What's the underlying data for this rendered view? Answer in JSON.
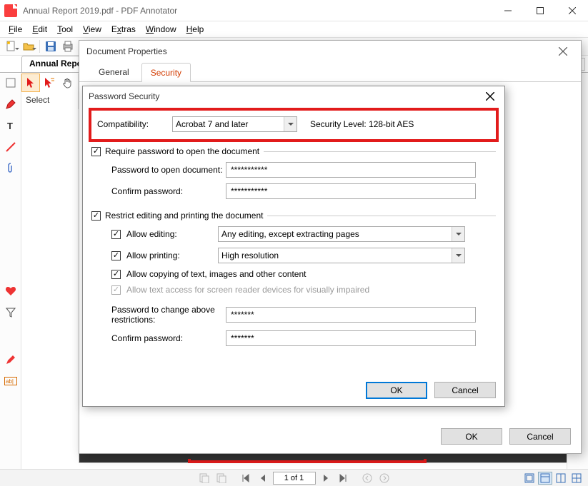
{
  "window": {
    "title": "Annual Report 2019.pdf - PDF Annotator",
    "doctab": "Annual Report"
  },
  "menu": {
    "file": "File",
    "edit": "Edit",
    "tool": "Tool",
    "view": "View",
    "extras": "Extras",
    "window": "Window",
    "help": "Help"
  },
  "tooltray": {
    "select": "Select"
  },
  "status": {
    "page": "1 of 1"
  },
  "docprops": {
    "title": "Document Properties",
    "tab_general": "General",
    "tab_security": "Security",
    "ok": "OK",
    "cancel": "Cancel"
  },
  "sec": {
    "title": "Password Security",
    "compat_label": "Compatibility:",
    "compat_value": "Acrobat 7 and later",
    "level": "Security Level: 128-bit AES",
    "require_open": "Require password to open the document",
    "pw_open_label": "Password to open document:",
    "pw_open_value": "***********",
    "pw_open_confirm_label": "Confirm password:",
    "pw_open_confirm_value": "***********",
    "restrict": "Restrict editing and printing the document",
    "allow_edit_label": "Allow editing:",
    "allow_edit_value": "Any editing, except extracting pages",
    "allow_print_label": "Allow printing:",
    "allow_print_value": "High resolution",
    "allow_copy": "Allow copying of text, images and other content",
    "screen_reader": "Allow text access for screen reader devices for visually impaired",
    "pw_change_label": "Password to change above restrictions:",
    "pw_change_value": "*******",
    "pw_change_confirm_label": "Confirm password:",
    "pw_change_confirm_value": "*******",
    "ok": "OK",
    "cancel": "Cancel"
  }
}
